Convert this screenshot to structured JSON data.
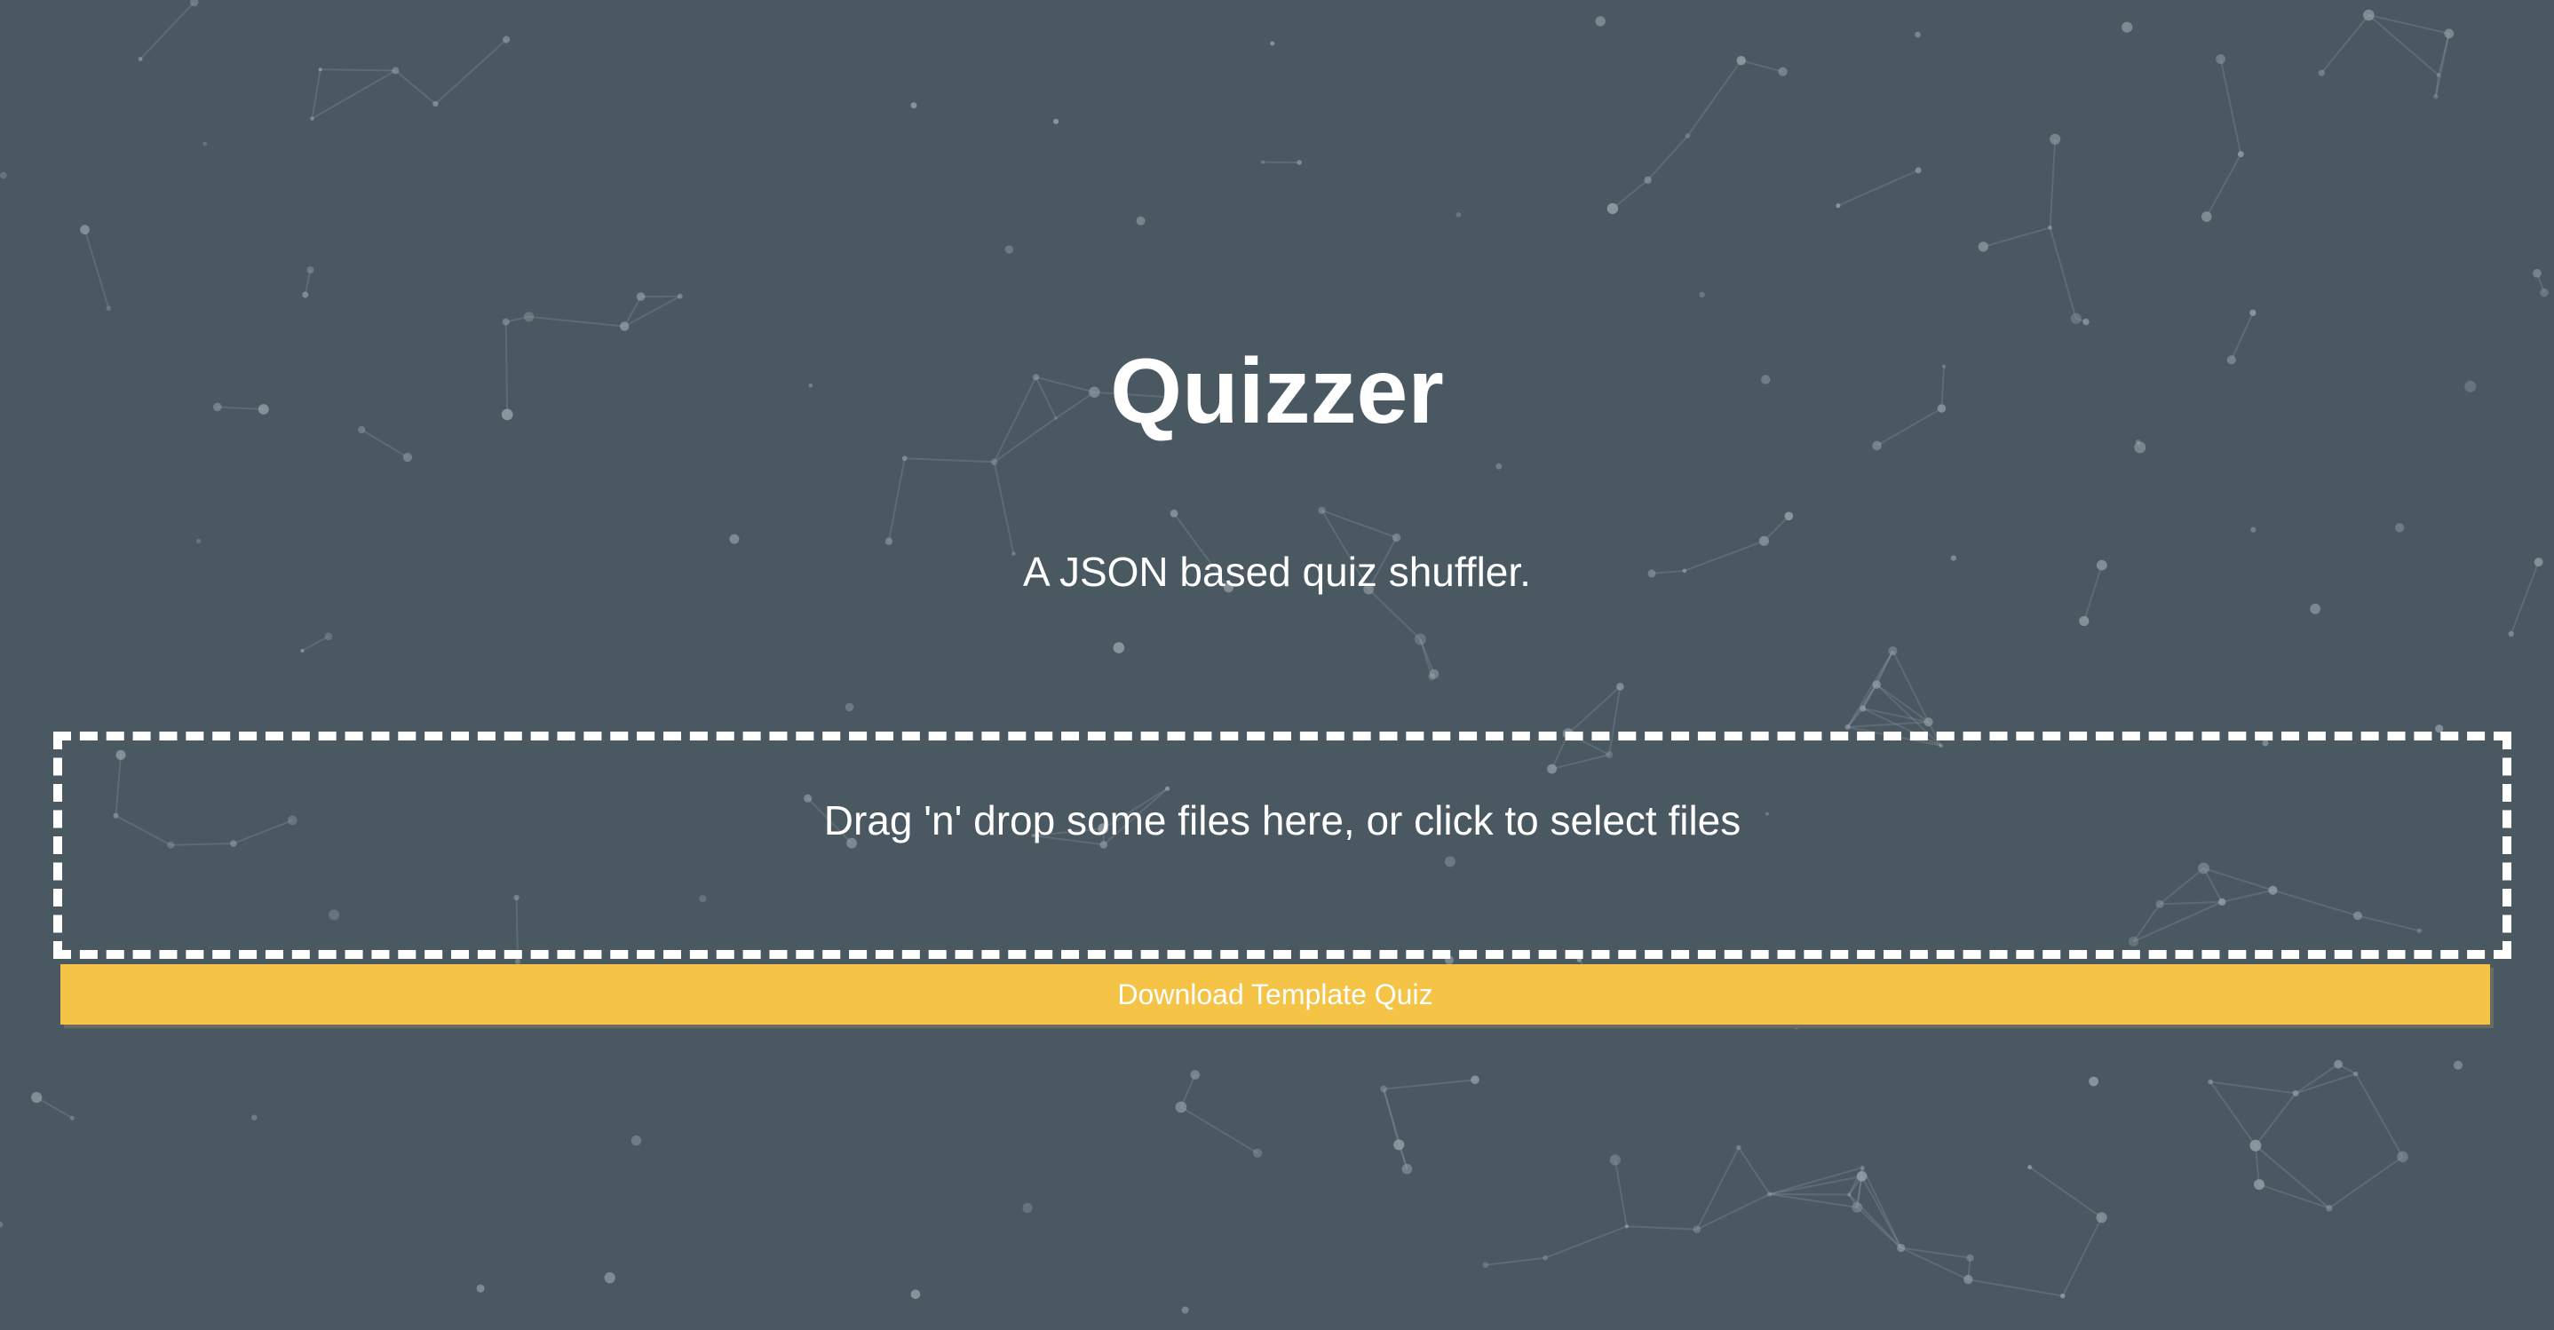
{
  "header": {
    "title": "Quizzer",
    "subtitle": "A JSON based quiz shuffler."
  },
  "dropzone": {
    "label": "Drag 'n' drop some files here, or click to select files"
  },
  "actions": {
    "download_label": "Download Template Quiz"
  },
  "colors": {
    "background": "#4a5862",
    "accent": "#f5c345",
    "text": "#ffffff",
    "particles": "#9aa4ab"
  }
}
